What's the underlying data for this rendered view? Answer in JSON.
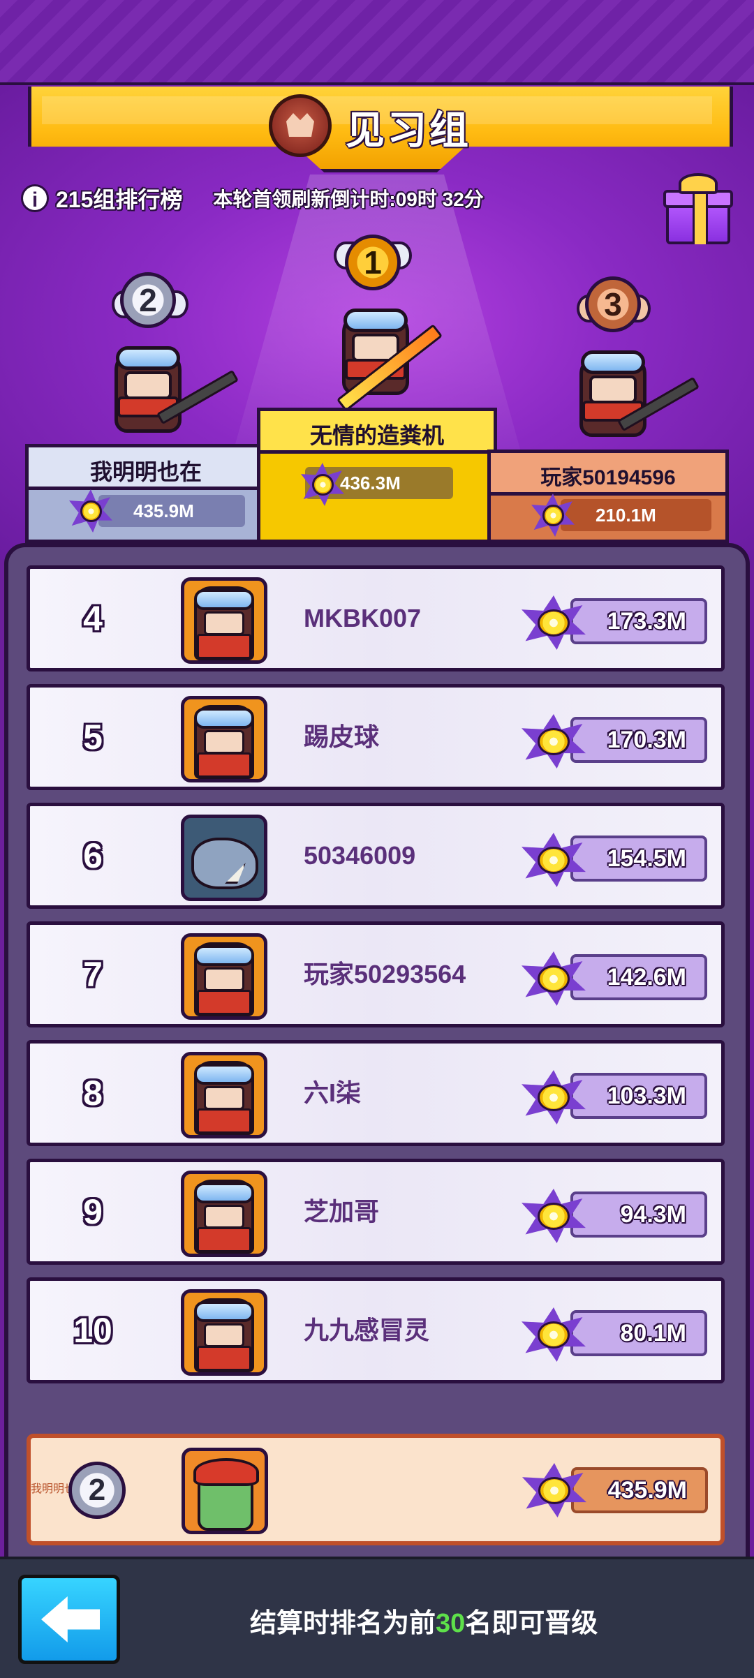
{
  "banner": {
    "title": "见习组"
  },
  "header": {
    "group_rank": "215组排行榜",
    "countdown": "本轮首领刷新倒计时:09时 32分"
  },
  "podium": [
    {
      "rank": "1",
      "name": "无情的造粪机",
      "score": "436.3M"
    },
    {
      "rank": "2",
      "name": "我明明也在",
      "score": "435.9M"
    },
    {
      "rank": "3",
      "name": "玩家50194596",
      "score": "210.1M"
    }
  ],
  "rows": [
    {
      "rank": "4",
      "name": "MKBK007",
      "score": "173.3M",
      "avatar": "ninja-avatar"
    },
    {
      "rank": "5",
      "name": "踢皮球",
      "score": "170.3M",
      "avatar": "ninja-avatar"
    },
    {
      "rank": "6",
      "name": "50346009",
      "score": "154.5M",
      "avatar": "rhino-avatar"
    },
    {
      "rank": "7",
      "name": "玩家50293564",
      "score": "142.6M",
      "avatar": "ninja-avatar"
    },
    {
      "rank": "8",
      "name": "六I柒",
      "score": "103.3M",
      "avatar": "ninja-avatar"
    },
    {
      "rank": "9",
      "name": "芝加哥",
      "score": "94.3M",
      "avatar": "ninja-avatar"
    },
    {
      "rank": "10",
      "name": "九九感冒灵",
      "score": "80.1M",
      "avatar": "ninja-avatar"
    }
  ],
  "me": {
    "rank": "2",
    "name": "我明明也在",
    "score": "435.9M",
    "avatar": "zombie-avatar"
  },
  "footer": {
    "text_before": "结算时排名为前",
    "highlight": "30",
    "text_after": "名即可晋级"
  },
  "icons": [
    "info-icon",
    "gift-icon",
    "crown-icon",
    "star-gem-icon",
    "back-arrow-icon",
    "medal-icon"
  ],
  "colors": {
    "accent_gold": "#ffbb12",
    "panel_purple": "#5d4a7c",
    "highlight_green": "#5ee04a"
  }
}
